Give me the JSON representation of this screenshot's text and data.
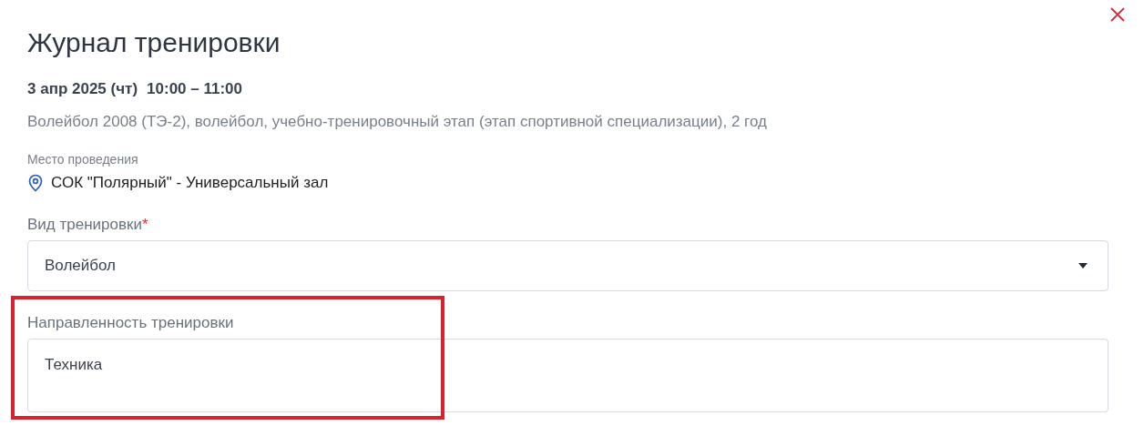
{
  "dialog": {
    "title": "Журнал тренировки"
  },
  "session": {
    "date": "3 апр 2025 (чт)",
    "time": "10:00 – 11:00",
    "description": "Волейбол 2008 (ТЭ-2), волейбол, учебно-тренировочный этап (этап спортивной специализации), 2 год"
  },
  "venue": {
    "label": "Место проведения",
    "name": "СОК \"Полярный\" - Универсальный зал"
  },
  "fields": [
    {
      "kind": "select",
      "label": "Вид тренировки",
      "required_mark": "*",
      "value": "Волейбол",
      "highlighted": false
    },
    {
      "kind": "textarea",
      "label": "Направленность тренировки",
      "value": "Техника",
      "highlighted": true
    }
  ]
}
